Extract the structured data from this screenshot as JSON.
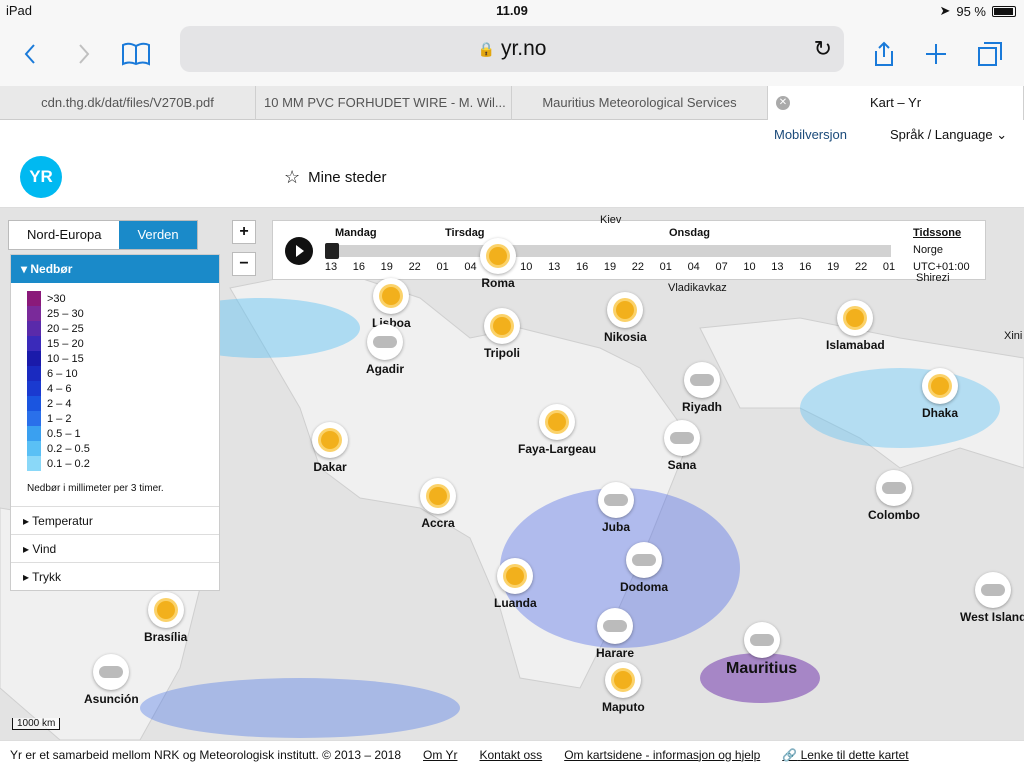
{
  "status": {
    "device": "iPad",
    "time": "11.09",
    "battery": "95 %"
  },
  "browser": {
    "url": "yr.no",
    "tabs": [
      "cdn.thg.dk/dat/files/V270B.pdf",
      "10 MM PVC FORHUDET WIRE - M. Wil...",
      "Mauritius Meteorological Services",
      "Kart – Yr"
    ]
  },
  "nav": {
    "mobile": "Mobilversjon",
    "language": "Språk / Language"
  },
  "header": {
    "logo": "YR",
    "mine_steder": "Mine steder"
  },
  "map": {
    "tab_nordeuropa": "Nord-Europa",
    "tab_verden": "Verden",
    "zoom_in": "+",
    "zoom_out": "−",
    "scale": "1000 km"
  },
  "legend": {
    "title": "Nedbør",
    "scale": [
      ">30",
      "25 – 30",
      "20 – 25",
      "15 – 20",
      "10 – 15",
      "6 – 10",
      "4 – 6",
      "2 – 4",
      "1 – 2",
      "0.5 – 1",
      "0.2 – 0.5",
      "0.1 – 0.2"
    ],
    "colors": [
      "#8a1a7a",
      "#7a2a9a",
      "#5a2aaa",
      "#3a2aba",
      "#1a1aaa",
      "#1a2ac0",
      "#1a3ad0",
      "#1a55e0",
      "#2a70ea",
      "#3aa0f0",
      "#5ac0f5",
      "#8ad8f8"
    ],
    "note": "Nedbør i millimeter per 3 timer.",
    "sections": [
      "Temperatur",
      "Vind",
      "Trykk"
    ]
  },
  "timeline": {
    "days": [
      "Mandag",
      "Tirsdag",
      "Onsdag"
    ],
    "hours": [
      "13",
      "16",
      "19",
      "22",
      "01",
      "04",
      "07",
      "10",
      "13",
      "16",
      "19",
      "22",
      "01",
      "04",
      "07",
      "10",
      "13",
      "16",
      "19",
      "22",
      "01"
    ],
    "tz_title": "Tidssone",
    "tz_region": "Norge",
    "tz_offset": "UTC+01:00"
  },
  "cities": [
    "Lisboa",
    "Roma",
    "Nikosia",
    "Islamabad",
    "Agadir",
    "Tripoli",
    "Riyadh",
    "Dhaka",
    "Dakar",
    "Faya-Largeau",
    "Sana",
    "Colombo",
    "Accra",
    "Juba",
    "Dodoma",
    "Luanda",
    "Brasília",
    "Harare",
    "Mauritius",
    "Asunción",
    "Maputo",
    "West Island",
    "Kiev",
    "Vladikavkaz",
    "Xini",
    "Shirezi"
  ],
  "footer": {
    "text": "Yr er et samarbeid mellom NRK og Meteorologisk institutt. © 2013 – 2018",
    "links": [
      "Om Yr",
      "Kontakt oss",
      "Om kartsidene - informasjon og hjelp",
      "Lenke til dette kartet"
    ]
  }
}
